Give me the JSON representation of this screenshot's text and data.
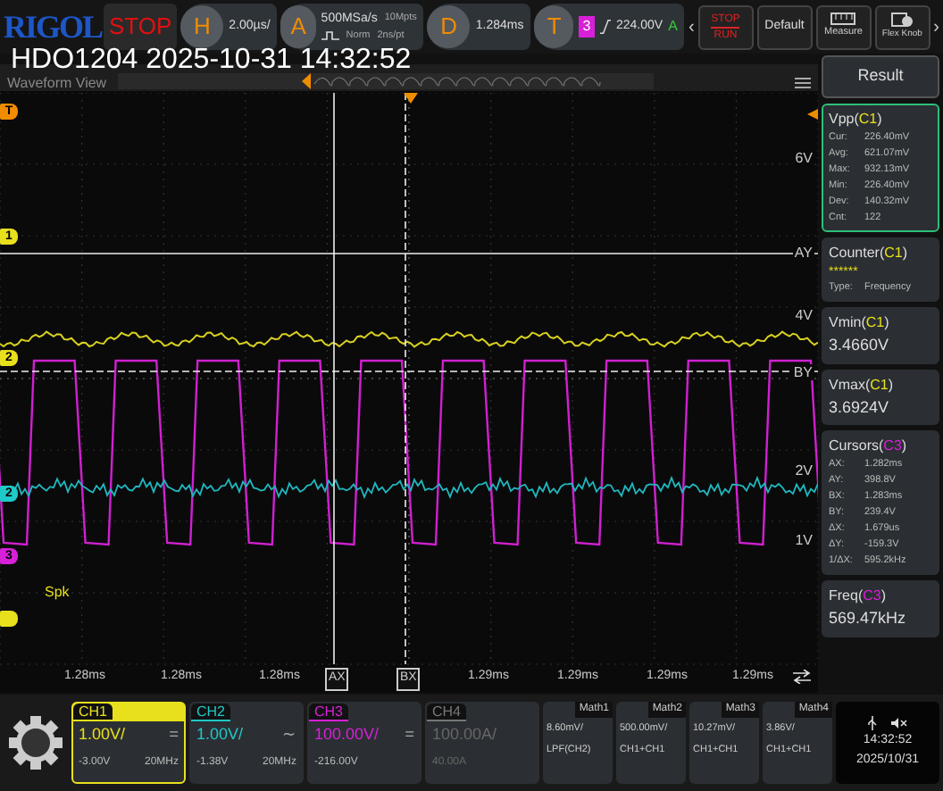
{
  "top_bar": {
    "logo": "RIGOL",
    "run_state": "STOP",
    "horizontal": {
      "key": "H",
      "scale": "2.00µs/"
    },
    "acquire": {
      "key": "A",
      "rate": "500MSa/s",
      "depth": "10Mpts",
      "mode": "Norm",
      "resolution": "2ns/pt"
    },
    "delay": {
      "key": "D",
      "value": "1.284ms"
    },
    "trigger": {
      "key": "T",
      "source": "3",
      "level": "224.00V",
      "status": "A"
    },
    "nav_left": "‹",
    "nav_right": "›",
    "buttons": [
      {
        "kind": "stoprun",
        "label": "STOP",
        "label2": "RUN"
      },
      {
        "kind": "default",
        "label": "Default"
      },
      {
        "kind": "measure",
        "label": "Measure"
      },
      {
        "kind": "knob",
        "label": "Flex Knob"
      }
    ]
  },
  "title_overlay": "HDO1204 2025-10-31 14:32:52",
  "waveform_view": {
    "title": "Waveform View",
    "left_markers": [
      {
        "text": "T",
        "color": "#f08c00"
      },
      {
        "text": "1",
        "color": "#e8e01c"
      },
      {
        "text": "2",
        "color": "#e8e01c"
      },
      {
        "text": "2",
        "color": "#20c8c8"
      },
      {
        "text": "3",
        "color": "#d820d8"
      },
      {
        "color": "#e8e01c"
      }
    ],
    "right_labels": [
      "6V",
      "AY",
      "4V",
      "BY",
      "2V",
      "1V"
    ],
    "spk": "Spk",
    "x_ticks": [
      "1.28ms",
      "1.28ms",
      "1.28ms",
      "AX",
      "BX",
      "1.29ms",
      "1.29ms",
      "1.29ms",
      "1.29ms"
    ]
  },
  "result_panel": {
    "title": "Result",
    "items": [
      {
        "kind": "stats",
        "prefix": "Vpp(",
        "source": "C1",
        "suffix": ")",
        "color": "#e8e01c",
        "selected": true,
        "rows": [
          [
            "Cur:",
            "226.40mV"
          ],
          [
            "Avg:",
            "621.07mV"
          ],
          [
            "Max:",
            "932.13mV"
          ],
          [
            "Min:",
            "226.40mV"
          ],
          [
            "Dev:",
            "140.32mV"
          ],
          [
            "Cnt:",
            "122"
          ]
        ]
      },
      {
        "kind": "counter",
        "prefix": "Counter(",
        "source": "C1",
        "suffix": ")",
        "color": "#e8e01c",
        "selected": false,
        "value": "******",
        "rows": [
          [
            "Type:",
            "Frequency"
          ]
        ]
      },
      {
        "kind": "value",
        "prefix": "Vmin(",
        "source": "C1",
        "suffix": ")",
        "color": "#e8e01c",
        "selected": false,
        "value": "3.4660V"
      },
      {
        "kind": "value",
        "prefix": "Vmax(",
        "source": "C1",
        "suffix": ")",
        "color": "#e8e01c",
        "selected": false,
        "value": "3.6924V"
      },
      {
        "kind": "cursors",
        "prefix": "Cursors(",
        "source": "C3",
        "suffix": ")",
        "color": "#d820d8",
        "selected": false,
        "rows": [
          [
            "AX:",
            "1.282ms"
          ],
          [
            "AY:",
            "398.8V"
          ],
          [
            "BX:",
            "1.283ms"
          ],
          [
            "BY:",
            "239.4V"
          ],
          [
            "ΔX:",
            "1.679us"
          ],
          [
            "ΔY:",
            "-159.3V"
          ],
          [
            "1/ΔX:",
            "595.2kHz"
          ]
        ]
      },
      {
        "kind": "value",
        "prefix": "Freq(",
        "source": "C3",
        "suffix": ")",
        "color": "#d820d8",
        "selected": false,
        "value": "569.47kHz"
      }
    ]
  },
  "channels": [
    {
      "name": "CH1",
      "color": "#e8e01c",
      "selected": true,
      "enabled": true,
      "scale": "1.00V/",
      "coupling": "=",
      "offset": "-3.00V",
      "bandwidth": "20MHz"
    },
    {
      "name": "CH2",
      "color": "#20c8c8",
      "selected": false,
      "enabled": true,
      "scale": "1.00V/",
      "coupling": "∼",
      "offset": "-1.38V",
      "bandwidth": "20MHz"
    },
    {
      "name": "CH3",
      "color": "#d820d8",
      "selected": false,
      "enabled": true,
      "scale": "100.00V/",
      "coupling": "=",
      "offset": "-216.00V"
    },
    {
      "name": "CH4",
      "color": "#777777",
      "selected": false,
      "enabled": false,
      "scale": "100.00A/",
      "offset": "40.00A"
    }
  ],
  "math": [
    {
      "name": "Math1",
      "scale": "8.60mV/",
      "source": "LPF(CH2)"
    },
    {
      "name": "Math2",
      "scale": "500.00mV/",
      "source": "CH1+CH1"
    },
    {
      "name": "Math3",
      "scale": "10.27mV/",
      "source": "CH1+CH1"
    },
    {
      "name": "Math4",
      "scale": "3.86V/",
      "source": "CH1+CH1"
    }
  ],
  "status": {
    "time": "14:32:52",
    "date": "2025/10/31"
  }
}
